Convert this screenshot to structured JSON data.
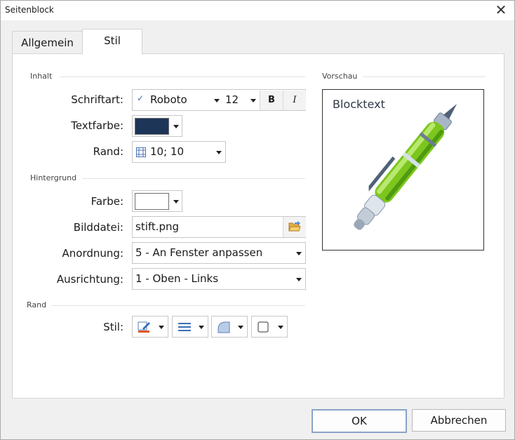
{
  "window": {
    "title": "Seitenblock",
    "close_glyph": "✕"
  },
  "tabs": [
    {
      "label": "Allgemein",
      "active": false
    },
    {
      "label": "Stil",
      "active": true
    }
  ],
  "sections": {
    "inhalt": "Inhalt",
    "hintergrund": "Hintergrund",
    "rand": "Rand",
    "vorschau": "Vorschau"
  },
  "content": {
    "font_label": "Schriftart:",
    "font_check": "✓",
    "font_value": "Roboto",
    "size_value": "12",
    "bold_label": "B",
    "italic_label": "I",
    "textcolor_label": "Textfarbe:",
    "textcolor_hex": "#1d3557",
    "margin_label": "Rand:",
    "margin_value": "10; 10"
  },
  "background": {
    "color_label": "Farbe:",
    "color_hex": "#ffffff",
    "imagefile_label": "Bilddatei:",
    "imagefile_value": "stift.png",
    "arrangement_label": "Anordnung:",
    "arrangement_value": "5 - An Fenster anpassen",
    "alignment_label": "Ausrichtung:",
    "alignment_value": "1 - Oben - Links"
  },
  "border": {
    "style_label": "Stil:"
  },
  "preview": {
    "text": "Blocktext"
  },
  "footer": {
    "ok_label": "OK",
    "cancel_label": "Abbrechen"
  },
  "colors": {
    "accent": "#8aa3c8",
    "pen_green": "#7cc61e",
    "pen_grey": "#a9b6c7"
  }
}
